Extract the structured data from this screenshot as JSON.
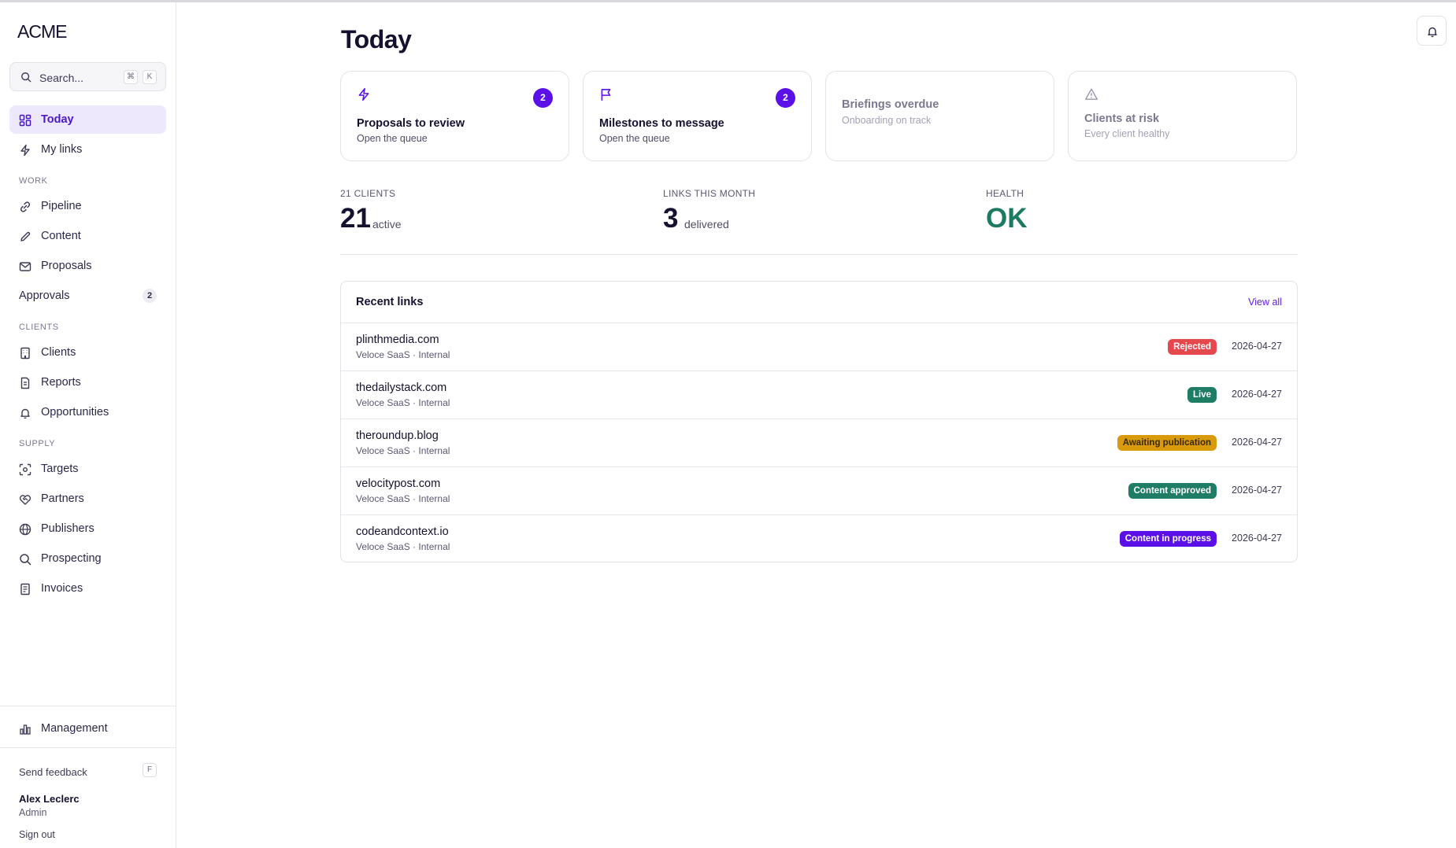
{
  "brand": "ACME",
  "search": {
    "placeholder": "Search...",
    "shortcut_mod": "⌘",
    "shortcut_key": "K"
  },
  "nav": {
    "top": [
      {
        "label": "Today",
        "icon": "grid-icon"
      },
      {
        "label": "My links",
        "icon": "bolt-icon"
      }
    ],
    "sections": [
      {
        "label": "WORK",
        "items": [
          {
            "label": "Pipeline",
            "icon": "link-icon"
          },
          {
            "label": "Content",
            "icon": "pencil-icon"
          },
          {
            "label": "Proposals",
            "icon": "mail-icon"
          },
          {
            "label": "Approvals",
            "badge": "2"
          }
        ]
      },
      {
        "label": "CLIENTS",
        "items": [
          {
            "label": "Clients",
            "icon": "building-icon"
          },
          {
            "label": "Reports",
            "icon": "document-icon"
          },
          {
            "label": "Opportunities",
            "icon": "bell-icon"
          }
        ]
      },
      {
        "label": "SUPPLY",
        "items": [
          {
            "label": "Targets",
            "icon": "target-icon"
          },
          {
            "label": "Partners",
            "icon": "handshake-icon"
          },
          {
            "label": "Publishers",
            "icon": "globe-icon"
          },
          {
            "label": "Prospecting",
            "icon": "search-icon"
          },
          {
            "label": "Invoices",
            "icon": "receipt-icon"
          }
        ]
      }
    ],
    "management": "Management"
  },
  "footer": {
    "feedback": "Send feedback",
    "feedback_key": "F",
    "user_name": "Alex Leclerc",
    "user_role": "Admin",
    "sign_out": "Sign out"
  },
  "page": {
    "title": "Today"
  },
  "cards": [
    {
      "title": "Proposals to review",
      "subtitle": "Open the queue",
      "badge": "2",
      "icon": "bolt-icon"
    },
    {
      "title": "Milestones to message",
      "subtitle": "Open the queue",
      "badge": "2",
      "icon": "flag-icon"
    },
    {
      "title": "Briefings overdue",
      "subtitle": "Onboarding on track"
    },
    {
      "title": "Clients at risk",
      "subtitle": "Every client healthy",
      "icon": "warning-icon"
    }
  ],
  "stats": [
    {
      "label": "21 CLIENTS",
      "value": "21",
      "unit": "active"
    },
    {
      "label": "LINKS THIS MONTH",
      "value": "3",
      "unit": "delivered"
    },
    {
      "label": "HEALTH",
      "value": "OK"
    }
  ],
  "recent": {
    "title": "Recent links",
    "view_all": "View all",
    "rows": [
      {
        "domain": "plinthmedia.com",
        "meta": "Veloce SaaS · Internal",
        "status": "Rejected",
        "status_color": "#e5484d",
        "date": "2026-04-27"
      },
      {
        "domain": "thedailystack.com",
        "meta": "Veloce SaaS · Internal",
        "status": "Live",
        "status_color": "#1f7d66",
        "date": "2026-04-27"
      },
      {
        "domain": "theroundup.blog",
        "meta": "Veloce SaaS · Internal",
        "status": "Awaiting publication",
        "status_color": "#d99a0c",
        "date": "2026-04-27"
      },
      {
        "domain": "velocitypost.com",
        "meta": "Veloce SaaS · Internal",
        "status": "Content approved",
        "status_color": "#1f7d66",
        "date": "2026-04-27"
      },
      {
        "domain": "codeandcontext.io",
        "meta": "Veloce SaaS · Internal",
        "status": "Content in progress",
        "status_color": "#5b10e8",
        "date": "2026-04-27"
      }
    ]
  },
  "colors": {
    "accent": "#5b10e8",
    "health": "#1c7a63"
  }
}
